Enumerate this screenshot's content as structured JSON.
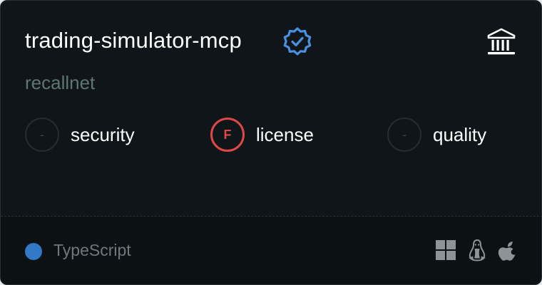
{
  "card": {
    "title": "trading-simulator-mcp",
    "owner": "recallnet",
    "verified_icon": "verified-badge-icon",
    "type_icon": "bank-building-icon"
  },
  "scores": [
    {
      "grade": "-",
      "label": "security",
      "status": "none"
    },
    {
      "grade": "F",
      "label": "license",
      "status": "fail"
    },
    {
      "grade": "-",
      "label": "quality",
      "status": "none"
    }
  ],
  "footer": {
    "language": "TypeScript",
    "language_color": "#3178c6",
    "platforms": [
      "windows-icon",
      "linux-icon",
      "apple-icon"
    ]
  },
  "colors": {
    "background": "#0f1518",
    "verified": "#4a90e2",
    "fail": "#e04848"
  }
}
